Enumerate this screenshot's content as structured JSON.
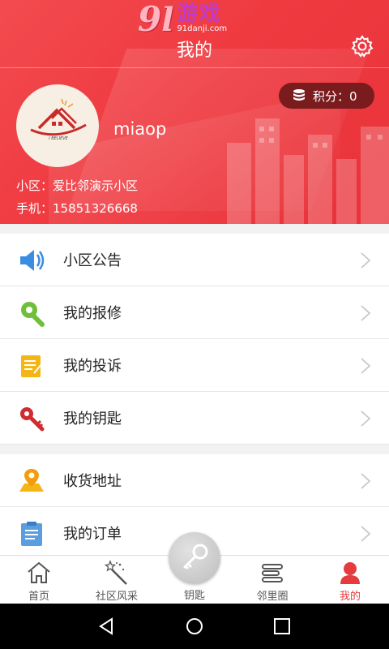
{
  "watermark": {
    "num": "9",
    "cn": "游戏",
    "url": "91danji.com"
  },
  "header": {
    "title": "我的",
    "points_label": "积分：0",
    "username": "miaop",
    "community": "小区：爱比邻演示小区",
    "phone": "手机：15851326668",
    "avatar_text": "I BELIEVE"
  },
  "menu": {
    "group1": [
      {
        "label": "小区公告",
        "icon": "speaker-icon"
      },
      {
        "label": "我的报修",
        "icon": "wrench-icon"
      },
      {
        "label": "我的投诉",
        "icon": "notepad-icon"
      },
      {
        "label": "我的钥匙",
        "icon": "key-icon"
      }
    ],
    "group2": [
      {
        "label": "收货地址",
        "icon": "map-pin-icon"
      },
      {
        "label": "我的订单",
        "icon": "clipboard-icon"
      }
    ]
  },
  "bottom_nav": [
    {
      "label": "首页",
      "icon": "home-icon"
    },
    {
      "label": "社区风采",
      "icon": "magic-wand-icon"
    },
    {
      "label": "钥匙",
      "icon": "key-icon"
    },
    {
      "label": "邻里圈",
      "icon": "lines-icon"
    },
    {
      "label": "我的",
      "icon": "person-icon",
      "active": true
    }
  ],
  "colors": {
    "primary": "#ef3a40",
    "points_bg": "#7a1b1e",
    "active": "#e53a3e"
  }
}
